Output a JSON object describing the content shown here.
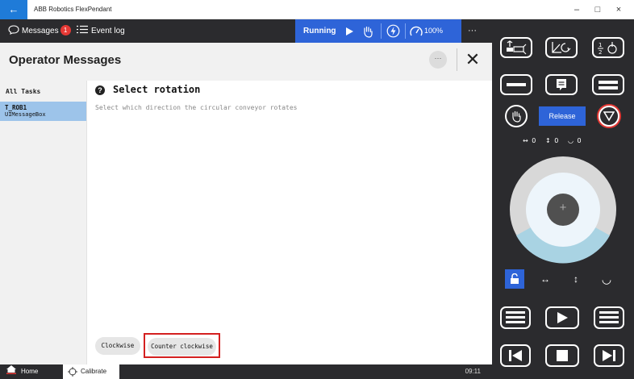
{
  "window": {
    "title": "ABB Robotics FlexPendant",
    "back_glyph": "←",
    "min_glyph": "–",
    "max_glyph": "□",
    "close_glyph": "×"
  },
  "topbar": {
    "messages_label": "Messages",
    "messages_count": "1",
    "eventlog_label": "Event log",
    "status_label": "Running",
    "speed_label": "100%",
    "overflow_glyph": "···"
  },
  "header": {
    "title": "Operator Messages",
    "more_glyph": "···",
    "close_glyph": "✕"
  },
  "tasks": {
    "heading": "All Tasks",
    "items": [
      {
        "name": "T_ROB1",
        "module": "UIMessageBox"
      }
    ]
  },
  "message": {
    "icon_glyph": "?",
    "title": "Select rotation",
    "description": "Select which direction the circular conveyor rotates",
    "buttons": [
      "Clockwise",
      "Counter clockwise"
    ]
  },
  "bottombar": {
    "home_label": "Home",
    "calibrate_label": "Calibrate",
    "time": "09:11"
  },
  "panel": {
    "release_label": "Release",
    "readout": {
      "x": "0",
      "y": "0",
      "z": "0"
    },
    "joystick_center_glyph": "+"
  },
  "colors": {
    "accent": "#2e64d8",
    "dark": "#2b2b2e",
    "selected_task": "#9dc4ea",
    "alert": "#e53935",
    "highlight_border": "#d42020"
  }
}
